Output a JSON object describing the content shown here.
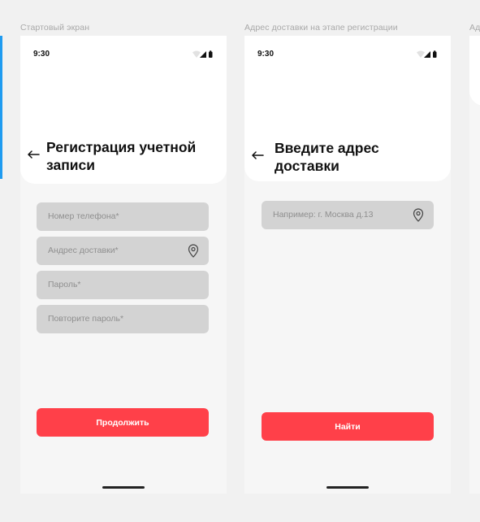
{
  "screens": [
    {
      "label": "Стартовый экран",
      "time": "9:30",
      "title_line1": "Регистрация учетной",
      "title_line2": "записи",
      "fields": [
        {
          "placeholder": "Номер телефона*",
          "has_pin": false
        },
        {
          "placeholder": "Андрес доставки*",
          "has_pin": true
        },
        {
          "placeholder": "Пароль*",
          "has_pin": false
        },
        {
          "placeholder": "Повторите пароль*",
          "has_pin": false
        }
      ],
      "button_label": "Продолжить"
    },
    {
      "label": "Адрес доставки на этапе регистрации",
      "time": "9:30",
      "title_line1": "Введите адрес",
      "title_line2": "доставки",
      "fields": [
        {
          "placeholder": "Например: г. Москва д.13",
          "has_pin": true
        }
      ],
      "button_label": "Найти"
    },
    {
      "label": "Ад"
    }
  ],
  "colors": {
    "accent": "#ff4049",
    "field_bg": "#d3d3d3",
    "canvas_bg": "#f1f1f1",
    "selection_edge": "#1f9bf0"
  },
  "icons": [
    "back-arrow-icon",
    "map-pin-icon",
    "wifi-icon",
    "signal-icon",
    "battery-icon"
  ]
}
